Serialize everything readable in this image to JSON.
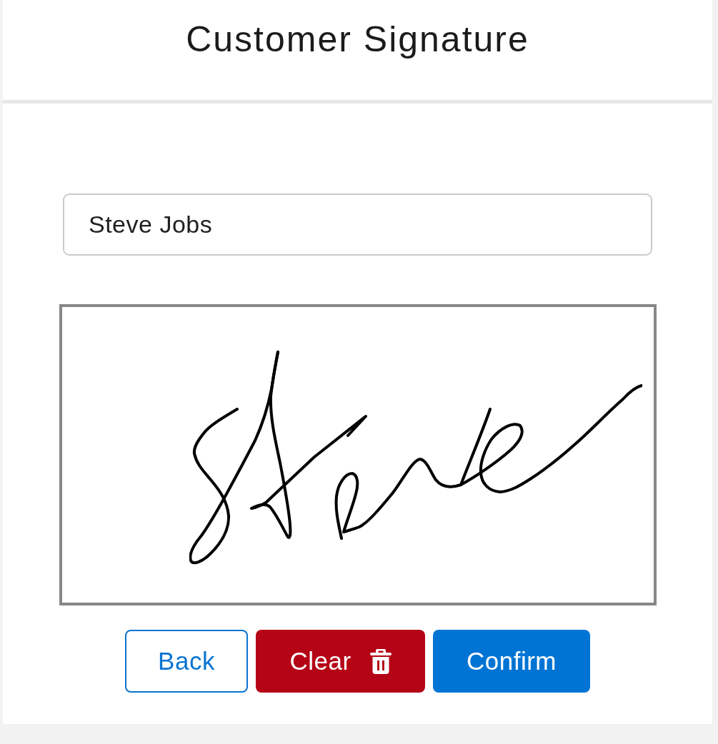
{
  "header": {
    "title": "Customer Signature"
  },
  "name_field": {
    "value": "Steve Jobs"
  },
  "signature_pad": {
    "signed": true
  },
  "buttons": [
    {
      "label": "Back",
      "kind": "outline",
      "trailing_icon": false
    },
    {
      "label": "Clear",
      "kind": "danger",
      "trailing_icon": true
    },
    {
      "label": "Confirm",
      "kind": "primary",
      "trailing_icon": false
    }
  ]
}
